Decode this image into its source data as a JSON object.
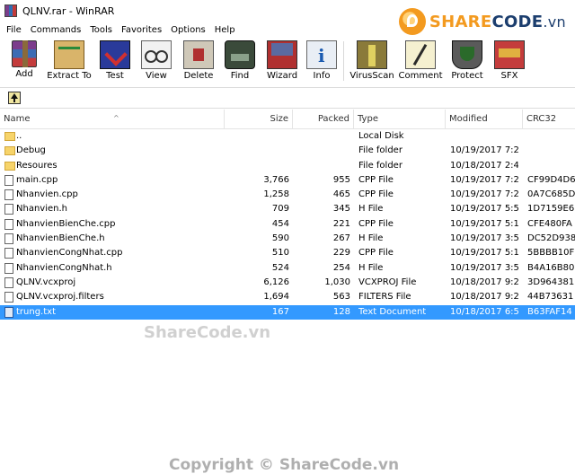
{
  "window": {
    "title": "QLNV.rar - WinRAR"
  },
  "logo": {
    "brand_share": "SHARE",
    "brand_code": "CODE",
    "brand_suffix": ".vn"
  },
  "menu": [
    "File",
    "Commands",
    "Tools",
    "Favorites",
    "Options",
    "Help"
  ],
  "toolbar": [
    {
      "label": "Add",
      "icon": "add-archive-icon"
    },
    {
      "label": "Extract To",
      "icon": "extract-icon"
    },
    {
      "label": "Test",
      "icon": "test-icon"
    },
    {
      "label": "View",
      "icon": "view-icon"
    },
    {
      "label": "Delete",
      "icon": "delete-icon"
    },
    {
      "label": "Find",
      "icon": "find-icon"
    },
    {
      "label": "Wizard",
      "icon": "wizard-icon"
    },
    {
      "label": "Info",
      "icon": "info-icon"
    },
    {
      "label": "VirusScan",
      "icon": "virus-scan-icon"
    },
    {
      "label": "Comment",
      "icon": "comment-icon"
    },
    {
      "label": "Protect",
      "icon": "protect-icon"
    },
    {
      "label": "SFX",
      "icon": "sfx-icon"
    }
  ],
  "columns": {
    "name": "Name",
    "size": "Size",
    "packed": "Packed",
    "type": "Type",
    "modified": "Modified",
    "crc": "CRC32"
  },
  "files": [
    {
      "name": "..",
      "size": "",
      "packed": "",
      "type": "Local Disk",
      "modified": "",
      "crc": "",
      "kind": "folder"
    },
    {
      "name": "Debug",
      "size": "",
      "packed": "",
      "type": "File folder",
      "modified": "10/19/2017 7:2...",
      "crc": "",
      "kind": "folder"
    },
    {
      "name": "Resoures",
      "size": "",
      "packed": "",
      "type": "File folder",
      "modified": "10/18/2017 2:4...",
      "crc": "",
      "kind": "folder"
    },
    {
      "name": "main.cpp",
      "size": "3,766",
      "packed": "955",
      "type": "CPP File",
      "modified": "10/19/2017 7:2...",
      "crc": "CF99D4D6",
      "kind": "file"
    },
    {
      "name": "Nhanvien.cpp",
      "size": "1,258",
      "packed": "465",
      "type": "CPP File",
      "modified": "10/19/2017 7:2...",
      "crc": "0A7C685D",
      "kind": "file"
    },
    {
      "name": "Nhanvien.h",
      "size": "709",
      "packed": "345",
      "type": "H File",
      "modified": "10/19/2017 5:5...",
      "crc": "1D7159E6",
      "kind": "file"
    },
    {
      "name": "NhanvienBienChe.cpp",
      "size": "454",
      "packed": "221",
      "type": "CPP File",
      "modified": "10/19/2017 5:1...",
      "crc": "CFE480FA",
      "kind": "file"
    },
    {
      "name": "NhanvienBienChe.h",
      "size": "590",
      "packed": "267",
      "type": "H File",
      "modified": "10/19/2017 3:5...",
      "crc": "DC52D938",
      "kind": "file"
    },
    {
      "name": "NhanvienCongNhat.cpp",
      "size": "510",
      "packed": "229",
      "type": "CPP File",
      "modified": "10/19/2017 5:1...",
      "crc": "5BBBB10F",
      "kind": "file"
    },
    {
      "name": "NhanvienCongNhat.h",
      "size": "524",
      "packed": "254",
      "type": "H File",
      "modified": "10/19/2017 3:5...",
      "crc": "B4A16B80",
      "kind": "file"
    },
    {
      "name": "QLNV.vcxproj",
      "size": "6,126",
      "packed": "1,030",
      "type": "VCXPROJ File",
      "modified": "10/18/2017 9:2...",
      "crc": "3D964381",
      "kind": "file"
    },
    {
      "name": "QLNV.vcxproj.filters",
      "size": "1,694",
      "packed": "563",
      "type": "FILTERS File",
      "modified": "10/18/2017 9:2...",
      "crc": "44B73631",
      "kind": "file"
    },
    {
      "name": "trung.txt",
      "size": "167",
      "packed": "128",
      "type": "Text Document",
      "modified": "10/18/2017 6:5...",
      "crc": "B63FAF14",
      "kind": "txt",
      "selected": true
    }
  ],
  "watermarks": {
    "center": "ShareCode.vn",
    "footer": "Copyright © ShareCode.vn"
  },
  "colors": {
    "selection": "#3399ff",
    "folder": "#f7d46a"
  }
}
